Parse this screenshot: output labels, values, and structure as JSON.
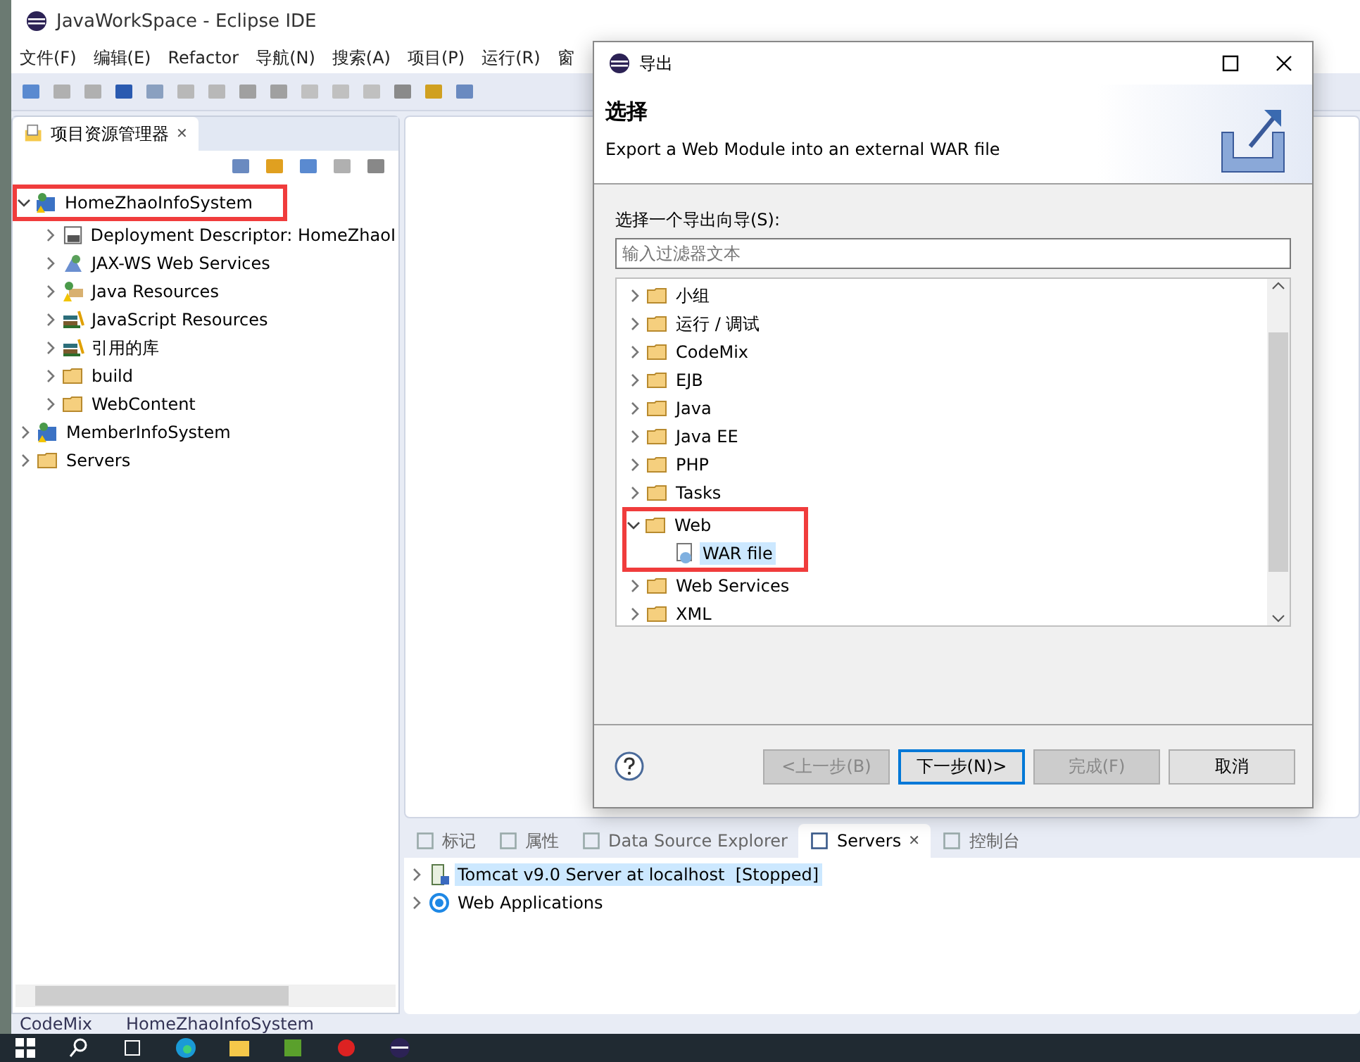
{
  "window": {
    "title": "JavaWorkSpace - Eclipse IDE"
  },
  "menu": [
    "文件(F)",
    "编辑(E)",
    "Refactor",
    "导航(N)",
    "搜索(A)",
    "项目(P)",
    "运行(R)",
    "窗"
  ],
  "explorer": {
    "title": "项目资源管理器",
    "close": "✕",
    "items": [
      {
        "label": "HomeZhaoInfoSystem",
        "kind": "project",
        "expanded": true,
        "highlighted": true,
        "highlight_with_children": false,
        "children": [
          {
            "label": "Deployment Descriptor: HomeZhaoI",
            "kind": "descriptor",
            "expanded": false
          },
          {
            "label": "JAX-WS Web Services",
            "kind": "services",
            "expanded": false
          },
          {
            "label": "Java Resources",
            "kind": "java",
            "expanded": false
          },
          {
            "label": "JavaScript Resources",
            "kind": "library",
            "expanded": false
          },
          {
            "label": "引用的库",
            "kind": "library",
            "expanded": false
          },
          {
            "label": "build",
            "kind": "folder",
            "expanded": false
          },
          {
            "label": "WebContent",
            "kind": "folder",
            "expanded": false
          }
        ]
      },
      {
        "label": "MemberInfoSystem",
        "kind": "project",
        "expanded": false
      },
      {
        "label": "Servers",
        "kind": "folder",
        "expanded": false
      }
    ]
  },
  "bottom_panel": {
    "tabs": [
      {
        "label": "标记",
        "selected": false
      },
      {
        "label": "属性",
        "selected": false
      },
      {
        "label": "Data Source Explorer",
        "selected": false
      },
      {
        "label": "Servers",
        "selected": true,
        "close": "✕"
      },
      {
        "label": "控制台",
        "selected": false
      }
    ],
    "rows": [
      {
        "label": "Tomcat v9.0 Server at localhost  [Stopped]",
        "kind": "server",
        "expanded": false,
        "selected": true
      },
      {
        "label": "Web Applications",
        "kind": "apps",
        "expanded": false,
        "selected": false
      }
    ]
  },
  "status_bar": [
    "CodeMix",
    "HomeZhaoInfoSystem"
  ],
  "dialog": {
    "title": "导出",
    "heading": "选择",
    "description": "Export a Web Module into an external WAR file",
    "wizard_label": "选择一个导出向导(S):",
    "filter": {
      "placeholder": "输入过滤器文本"
    },
    "items": [
      {
        "label": "小组",
        "kind": "folder",
        "expanded": false
      },
      {
        "label": "运行 / 调试",
        "kind": "folder",
        "expanded": false
      },
      {
        "label": "CodeMix",
        "kind": "folder",
        "expanded": false
      },
      {
        "label": "EJB",
        "kind": "folder",
        "expanded": false
      },
      {
        "label": "Java",
        "kind": "folder",
        "expanded": false
      },
      {
        "label": "Java EE",
        "kind": "folder",
        "expanded": false
      },
      {
        "label": "PHP",
        "kind": "folder",
        "expanded": false
      },
      {
        "label": "Tasks",
        "kind": "folder",
        "expanded": false
      },
      {
        "label": "Web",
        "kind": "folder",
        "expanded": true,
        "highlighted": true,
        "highlight_with_children": true,
        "children": [
          {
            "label": "WAR file",
            "kind": "war",
            "selected": true
          }
        ]
      },
      {
        "label": "Web Services",
        "kind": "folder",
        "expanded": false
      },
      {
        "label": "XML",
        "kind": "folder",
        "expanded": false
      }
    ],
    "buttons": [
      {
        "label": "<上一步(B)",
        "disabled": true,
        "default": false
      },
      {
        "label": "下一步(N)>",
        "disabled": false,
        "default": true
      },
      {
        "label": "完成(F)",
        "disabled": true,
        "default": false
      },
      {
        "label": "取消",
        "disabled": false,
        "default": false
      }
    ]
  }
}
